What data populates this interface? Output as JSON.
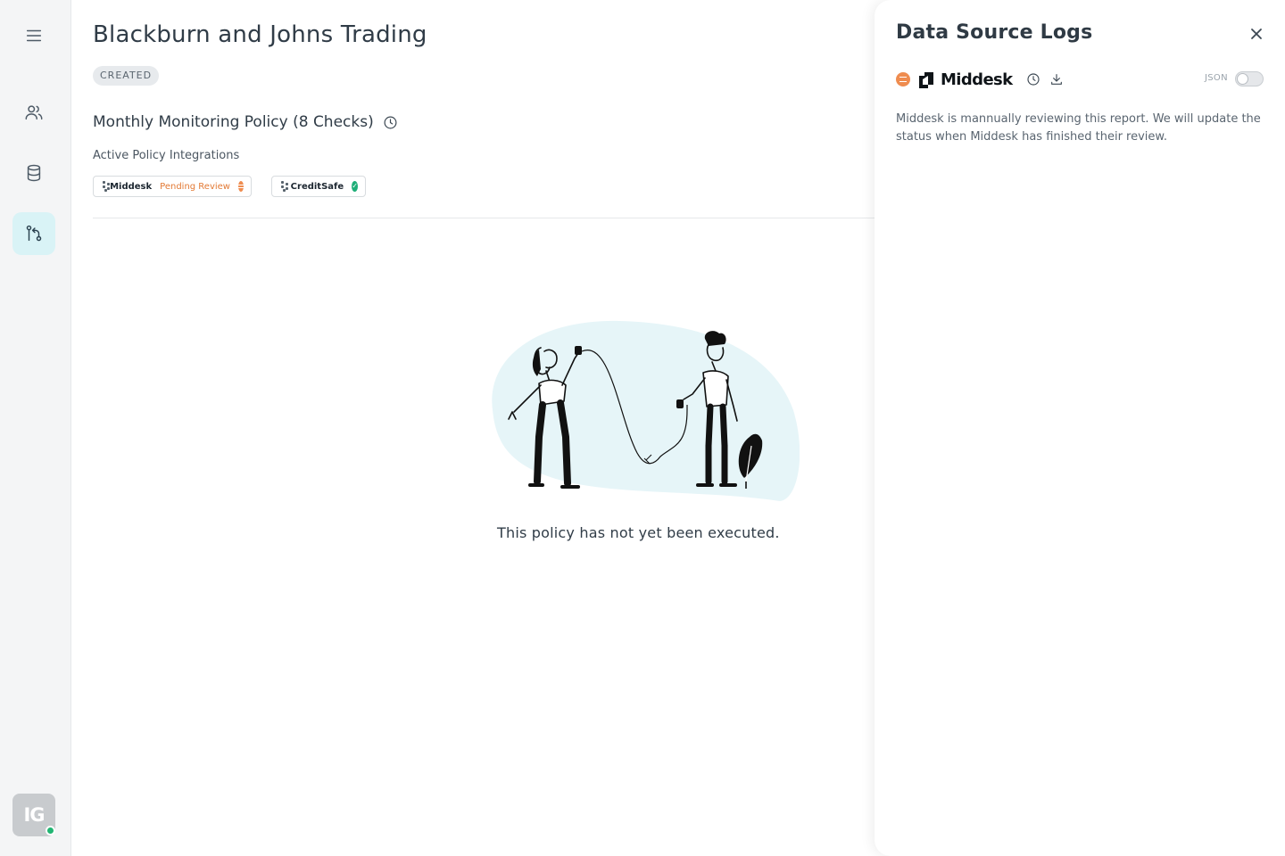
{
  "sidebar": {
    "items": [
      {
        "icon": "menu-icon"
      },
      {
        "icon": "users-icon"
      },
      {
        "icon": "database-icon"
      },
      {
        "icon": "workflow-icon",
        "active": true
      }
    ],
    "avatar": {
      "initials": "IG",
      "status_color": "#22b573"
    }
  },
  "main": {
    "title": "Blackburn and Johns Trading",
    "status": "CREATED",
    "policy_title": "Monthly Monitoring Policy (8 Checks)",
    "integrations_label": "Active Policy Integrations",
    "integrations": [
      {
        "name": "Middesk",
        "status": "Pending Review",
        "status_color": "#e37a35",
        "state": "pending"
      },
      {
        "name": "CreditSafe",
        "status": "",
        "status_color": "#1fae78",
        "state": "ok"
      }
    ],
    "empty_state": "This policy has not yet been executed."
  },
  "drawer": {
    "title": "Data Source Logs",
    "source_name": "Middesk",
    "toggle_label": "JSON",
    "toggle_on": false,
    "message": "Middesk is mannually reviewing this report. We will update the status when Middesk has finished their review."
  },
  "colors": {
    "accent_active_bg": "#d9f3f6",
    "pending": "#ef8c4f",
    "success": "#1fae78",
    "illustration_blob": "#e6f5f8"
  }
}
